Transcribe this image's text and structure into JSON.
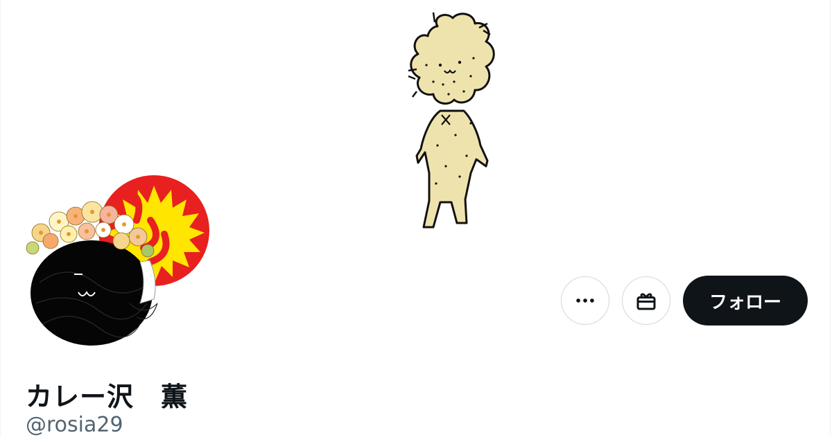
{
  "profile": {
    "display_name": "カレー沢　薫",
    "username": "@rosia29"
  },
  "actions": {
    "more_icon": "more-horizontal-icon",
    "gift_icon": "gift-icon",
    "follow_label": "フォロー"
  },
  "colors": {
    "follow_bg": "#0f1419",
    "follow_text": "#ffffff",
    "border": "#cfd9de",
    "handle": "#536471",
    "banner_creature": "#efe3ad",
    "badge_red": "#e8201f",
    "badge_yellow": "#ffe600"
  },
  "images": {
    "banner": "hand-drawn-creature-illustration",
    "avatar": "scribble-character-with-flower-crown-and-sticker"
  }
}
